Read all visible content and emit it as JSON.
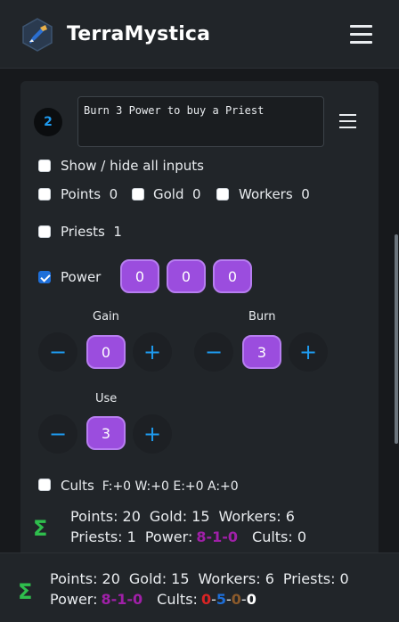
{
  "app": {
    "title": "TerraMystica"
  },
  "step": {
    "number": "2",
    "description": "Burn 3 Power to buy a Priest"
  },
  "inputs": {
    "show_hide_all": "Show / hide all inputs",
    "points": {
      "label": "Points",
      "value": "0",
      "checked": false
    },
    "gold": {
      "label": "Gold",
      "value": "0",
      "checked": false
    },
    "workers": {
      "label": "Workers",
      "value": "0",
      "checked": false
    },
    "priests": {
      "label": "Priests",
      "value": "1",
      "checked": false
    },
    "power": {
      "label": "Power",
      "checked": true,
      "bowls": [
        "0",
        "0",
        "0"
      ]
    },
    "gain": {
      "label": "Gain",
      "value": "0",
      "minus": "−",
      "plus": "+"
    },
    "burn": {
      "label": "Burn",
      "value": "3",
      "minus": "−",
      "plus": "+"
    },
    "use": {
      "label": "Use",
      "value": "3",
      "minus": "−",
      "plus": "+"
    },
    "cults": {
      "label": "Cults",
      "value": "F:+0 W:+0 E:+0 A:+0",
      "checked": false
    }
  },
  "step_summary": {
    "sigma": "Σ",
    "points": "Points: 20",
    "gold": "Gold: 15",
    "workers": "Workers: 6",
    "priests": "Priests: 1",
    "power_label": "Power:",
    "power_value": "8-1-0",
    "cults": "Cults: 0"
  },
  "total_summary": {
    "sigma": "Σ",
    "points": "Points: 20",
    "gold": "Gold: 15",
    "workers": "Workers: 6",
    "priests": "Priests: 0",
    "power_label": "Power:",
    "power_value": "8-1-0",
    "cults_label": "Cults:",
    "cult_f": "0",
    "cult_w": "5",
    "cult_e": "0",
    "cult_a": "0",
    "dash": "-"
  },
  "colors": {
    "accent": "#1e9bf0",
    "power_purple": "#9b4dde",
    "sigma_green": "#2fbe4d",
    "cult_fire": "#d92424",
    "cult_water": "#1e6fd9",
    "cult_earth": "#8b5a2b",
    "cult_air": "#ffffff"
  }
}
